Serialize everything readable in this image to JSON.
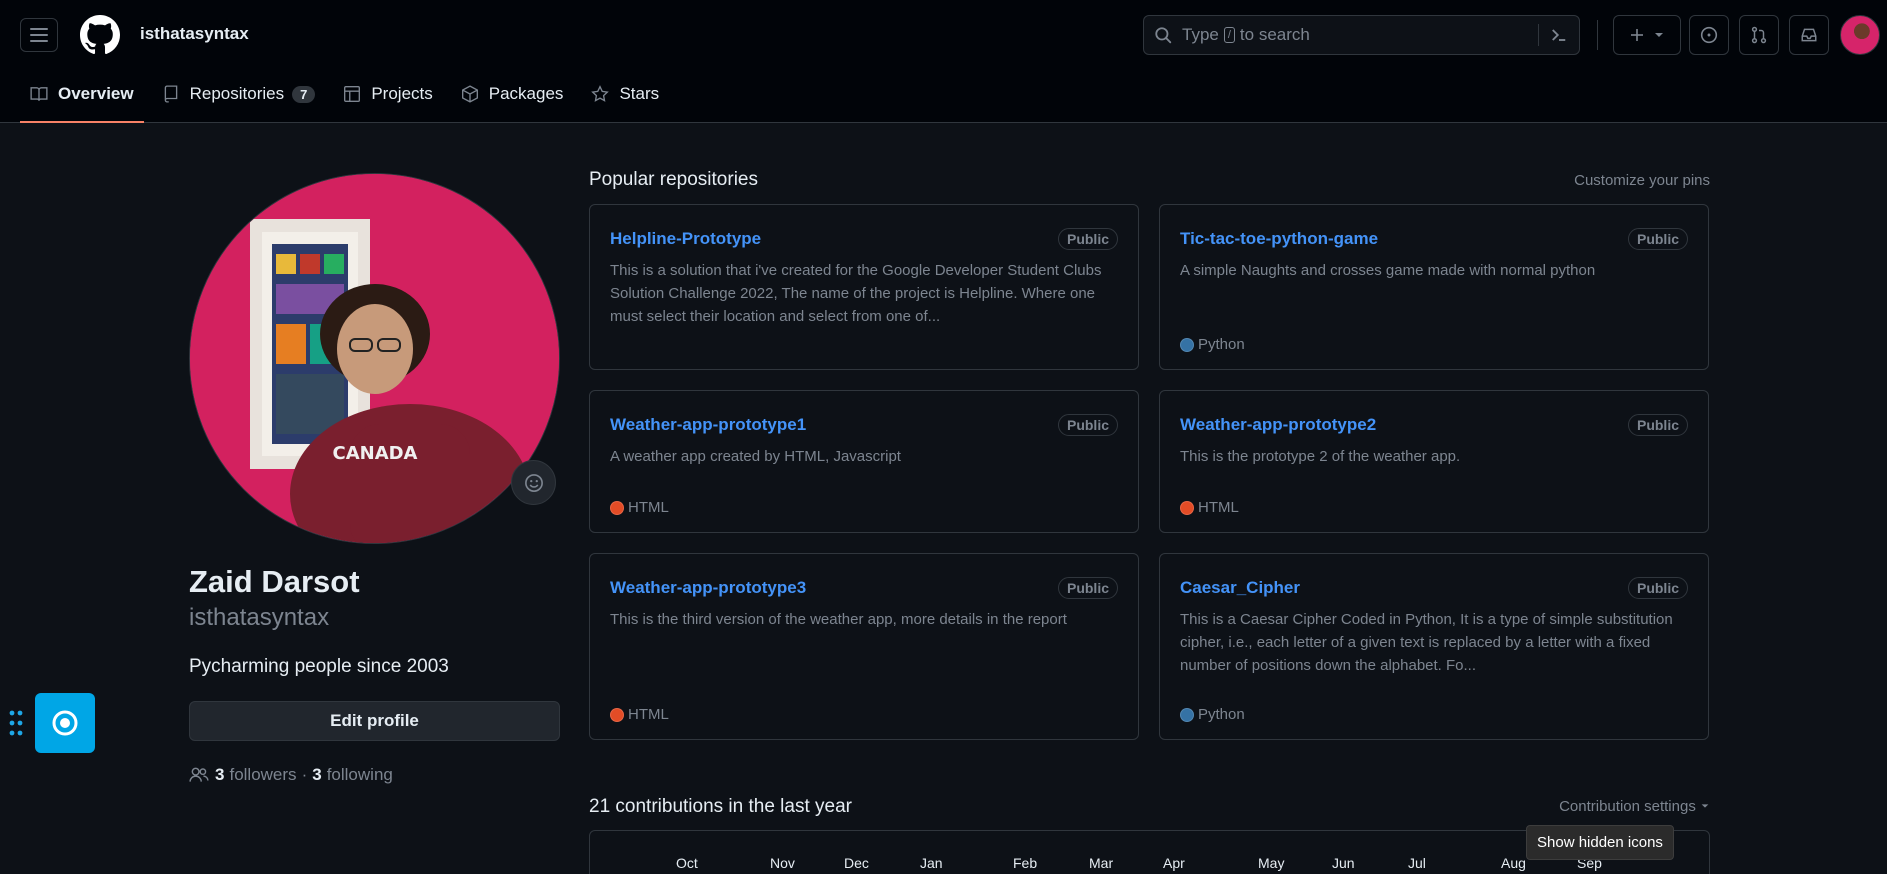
{
  "header": {
    "username": "isthatasyntax",
    "search_prefix": "Type",
    "search_key": "/",
    "search_suffix": "to search"
  },
  "tabs": [
    {
      "label": "Overview"
    },
    {
      "label": "Repositories",
      "count": "7"
    },
    {
      "label": "Projects"
    },
    {
      "label": "Packages"
    },
    {
      "label": "Stars"
    }
  ],
  "profile": {
    "full_name": "Zaid Darsot",
    "login": "isthatasyntax",
    "bio": "Pycharming people since 2003",
    "edit_label": "Edit profile",
    "followers_count": "3",
    "followers_label": "followers",
    "dot": "·",
    "following_count": "3",
    "following_label": "following"
  },
  "popular": {
    "title": "Popular repositories",
    "customize": "Customize your pins",
    "repos": [
      {
        "name": "Helpline-Prototype",
        "visibility": "Public",
        "description": "This is a solution that i've created for the Google Developer Student Clubs Solution Challenge 2022, The name of the project is Helpline. Where one must select their location and select from one of...",
        "language": ""
      },
      {
        "name": "Tic-tac-toe-python-game",
        "visibility": "Public",
        "description": "A simple Naughts and crosses game made with normal python",
        "language": "Python",
        "lang_color": "#3572A5"
      },
      {
        "name": "Weather-app-prototype1",
        "visibility": "Public",
        "description": "A weather app created by HTML, Javascript",
        "language": "HTML",
        "lang_color": "#e34c26"
      },
      {
        "name": "Weather-app-prototype2",
        "visibility": "Public",
        "description": "This is the prototype 2 of the weather app.",
        "language": "HTML",
        "lang_color": "#e34c26"
      },
      {
        "name": "Weather-app-prototype3",
        "visibility": "Public",
        "description": "This is the third version of the weather app, more details in the report",
        "language": "HTML",
        "lang_color": "#e34c26"
      },
      {
        "name": "Caesar_Cipher",
        "visibility": "Public",
        "description": "This is a Caesar Cipher Coded in Python, It is a type of simple substitution cipher, i.e., each letter of a given text is replaced by a letter with a fixed number of positions down the alphabet. Fo...",
        "language": "Python",
        "lang_color": "#3572A5"
      }
    ]
  },
  "contributions": {
    "title": "21 contributions in the last year",
    "settings": "Contribution settings",
    "months": [
      "Oct",
      "Nov",
      "Dec",
      "Jan",
      "Feb",
      "Mar",
      "Apr",
      "May",
      "Jun",
      "Jul",
      "Aug",
      "Sep"
    ]
  },
  "tooltip": "Show hidden icons",
  "colors": {
    "accent_link": "#4493f8",
    "tab_underline": "#f78166",
    "floating_button": "#00a6e6"
  }
}
